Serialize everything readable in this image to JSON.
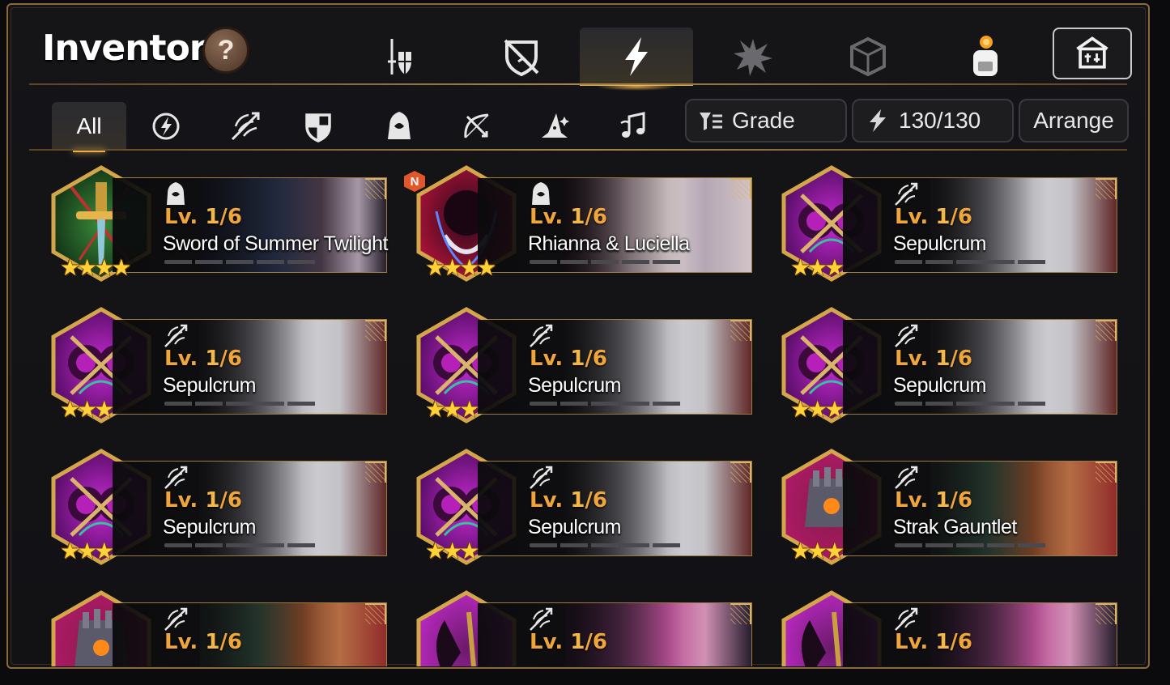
{
  "header": {
    "title": "Inventory",
    "help_label": "?"
  },
  "main_tabs": [
    {
      "name": "tab-equipment",
      "icon": "sword-shield-icon",
      "active": false
    },
    {
      "name": "tab-break-equipment",
      "icon": "broken-shield-icon",
      "active": false
    },
    {
      "name": "tab-weapons",
      "icon": "lightning-icon",
      "active": true
    },
    {
      "name": "tab-fragments",
      "icon": "splatter-icon",
      "active": false
    },
    {
      "name": "tab-materials",
      "icon": "cube-icon",
      "active": false
    },
    {
      "name": "tab-bag",
      "icon": "backpack-icon",
      "active": false,
      "has_notification": true
    }
  ],
  "extra_button_icon": "shop-icon",
  "filter_tabs": {
    "all_label": "All",
    "items": [
      {
        "name": "filter-all",
        "icon": "all"
      },
      {
        "name": "filter-mage",
        "icon": "orb-lightning-icon"
      },
      {
        "name": "filter-ranger",
        "icon": "arrow-wing-icon"
      },
      {
        "name": "filter-defender",
        "icon": "shield-icon"
      },
      {
        "name": "filter-assassin",
        "icon": "hooded-figure-icon"
      },
      {
        "name": "filter-archer",
        "icon": "bow-icon"
      },
      {
        "name": "filter-wizard",
        "icon": "wizard-hat-icon"
      },
      {
        "name": "filter-support",
        "icon": "music-note-icon"
      }
    ]
  },
  "controls": {
    "grade_label": "Grade",
    "capacity_label": "130/130",
    "arrange_label": "Arrange"
  },
  "colors": {
    "accent": "#e8b04a",
    "level": "#f0a53a",
    "gold_border": "#9b7a44"
  },
  "cards": [
    {
      "name": "Sword of Summer Twilight",
      "lv_prefix": "Lv. ",
      "level": "1",
      "max": "/6",
      "stars": 4,
      "class_icon": "hooded-figure-icon",
      "item": "sword",
      "art": "dark-hair",
      "new": false
    },
    {
      "name": "Rhianna & Luciella",
      "lv_prefix": "Lv. ",
      "level": "1",
      "max": "/6",
      "stars": 4,
      "class_icon": "hooded-figure-icon",
      "item": "blades",
      "art": "twins",
      "new": true,
      "new_label": "N"
    },
    {
      "name": "Sepulcrum",
      "lv_prefix": "Lv. ",
      "level": "1",
      "max": "/6",
      "stars": 3,
      "class_icon": "arrow-wing-icon",
      "item": "crossbow",
      "art": "silver",
      "new": false
    },
    {
      "name": "Sepulcrum",
      "lv_prefix": "Lv. ",
      "level": "1",
      "max": "/6",
      "stars": 3,
      "class_icon": "arrow-wing-icon",
      "item": "crossbow",
      "art": "silver",
      "new": false
    },
    {
      "name": "Sepulcrum",
      "lv_prefix": "Lv. ",
      "level": "1",
      "max": "/6",
      "stars": 3,
      "class_icon": "arrow-wing-icon",
      "item": "crossbow",
      "art": "silver",
      "new": false
    },
    {
      "name": "Sepulcrum",
      "lv_prefix": "Lv. ",
      "level": "1",
      "max": "/6",
      "stars": 3,
      "class_icon": "arrow-wing-icon",
      "item": "crossbow",
      "art": "silver",
      "new": false
    },
    {
      "name": "Sepulcrum",
      "lv_prefix": "Lv. ",
      "level": "1",
      "max": "/6",
      "stars": 3,
      "class_icon": "arrow-wing-icon",
      "item": "crossbow",
      "art": "silver",
      "new": false
    },
    {
      "name": "Sepulcrum",
      "lv_prefix": "Lv. ",
      "level": "1",
      "max": "/6",
      "stars": 3,
      "class_icon": "arrow-wing-icon",
      "item": "crossbow",
      "art": "silver",
      "new": false
    },
    {
      "name": "Strak Gauntlet",
      "lv_prefix": "Lv. ",
      "level": "1",
      "max": "/6",
      "stars": 3,
      "class_icon": "arrow-wing-icon",
      "item": "gauntlet",
      "art": "auburn",
      "new": false
    },
    {
      "name": "",
      "lv_prefix": "Lv. ",
      "level": "1",
      "max": "/6",
      "stars": 3,
      "class_icon": "arrow-wing-icon",
      "item": "gauntlet",
      "art": "auburn",
      "new": false
    },
    {
      "name": "",
      "lv_prefix": "Lv. ",
      "level": "1",
      "max": "/6",
      "stars": 3,
      "class_icon": "arrow-wing-icon",
      "item": "axe",
      "art": "pink",
      "new": false
    },
    {
      "name": "",
      "lv_prefix": "Lv. ",
      "level": "1",
      "max": "/6",
      "stars": 3,
      "class_icon": "arrow-wing-icon",
      "item": "axe",
      "art": "pink",
      "new": false
    }
  ]
}
